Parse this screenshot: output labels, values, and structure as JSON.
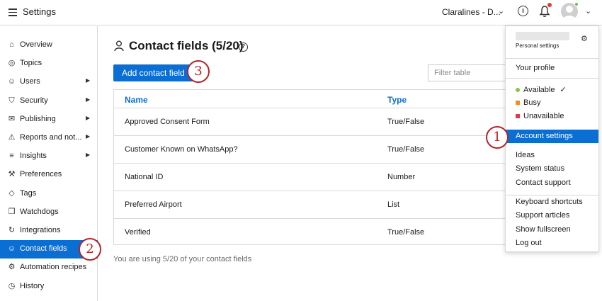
{
  "header": {
    "title": "Settings",
    "brand": "Claralines - D...",
    "help_glyph": "i"
  },
  "sidebar": {
    "items": [
      {
        "label": "Overview",
        "icon": "overview-icon"
      },
      {
        "label": "Topics",
        "icon": "topics-icon"
      },
      {
        "label": "Users",
        "icon": "users-icon",
        "arrow": true
      },
      {
        "label": "Security",
        "icon": "shield-icon",
        "arrow": true
      },
      {
        "label": "Publishing",
        "icon": "publishing-icon",
        "arrow": true
      },
      {
        "label": "Reports and not...",
        "icon": "warning-icon",
        "arrow": true
      },
      {
        "label": "Insights",
        "icon": "insights-icon",
        "arrow": true
      },
      {
        "label": "Preferences",
        "icon": "wrench-icon"
      },
      {
        "label": "Tags",
        "icon": "tag-icon"
      },
      {
        "label": "Watchdogs",
        "icon": "watchdog-icon"
      },
      {
        "label": "Integrations",
        "icon": "integrations-icon"
      },
      {
        "label": "Contact fields",
        "icon": "person-icon",
        "active": true
      },
      {
        "label": "Automation recipes",
        "icon": "automation-icon"
      },
      {
        "label": "History",
        "icon": "history-icon"
      }
    ]
  },
  "main": {
    "title": "Contact fields (5/20)",
    "add_label": "Add contact field",
    "filter_placeholder": "Filter table",
    "columns": [
      "Name",
      "Type"
    ],
    "rows": [
      {
        "name": "Approved Consent Form",
        "type": "True/False"
      },
      {
        "name": "Customer Known on WhatsApp?",
        "type": "True/False"
      },
      {
        "name": "National ID",
        "type": "Number"
      },
      {
        "name": "Preferred Airport",
        "type": "List"
      },
      {
        "name": "Verified",
        "type": "True/False"
      }
    ],
    "usage": "You are using 5/20 of your contact fields"
  },
  "dropdown": {
    "subtitle": "Personal settings",
    "profile": "Your profile",
    "status": [
      {
        "label": "Available",
        "color": "#8bc34a",
        "checked": true
      },
      {
        "label": "Busy",
        "color": "#f28c28"
      },
      {
        "label": "Unavailable",
        "color": "#e5394a"
      }
    ],
    "account_settings": "Account settings",
    "group2": [
      "Ideas",
      "System status",
      "Contact support"
    ],
    "group3": [
      "Keyboard shortcuts",
      "Support articles",
      "Show fullscreen",
      "Log out"
    ]
  },
  "callouts": [
    "1",
    "2",
    "3"
  ],
  "colors": {
    "accent": "#0b6ed2",
    "callout": "#b4232a"
  }
}
